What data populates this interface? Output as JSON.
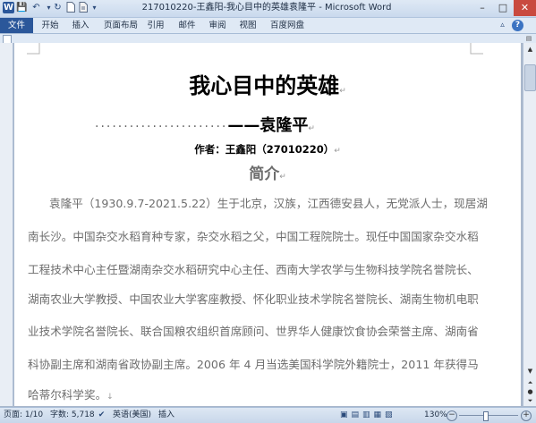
{
  "window": {
    "title": "217010220-王鑫阳-我心目中的英雄袁隆平  -  Microsoft Word",
    "controls": {
      "minimize": "–",
      "maximize": "□",
      "close": "✕"
    }
  },
  "quick_access": {
    "word_icon": "W",
    "save": "💾",
    "undo": "↶",
    "redo": "↻"
  },
  "ribbon": {
    "tabs": [
      "文件",
      "开始",
      "插入",
      "页面布局",
      "引用",
      "邮件",
      "审阅",
      "视图",
      "百度网盘"
    ]
  },
  "document": {
    "title": "我心目中的英雄",
    "leader": "·······················",
    "dash_name": "——袁隆平",
    "author": "作者：王鑫阳（27010220）",
    "section_heading": "简介",
    "body_lines": [
      "袁隆平（1930.9.7-2021.5.22）生于北京，汉族，江西德安县人，无党派人士，现居湖",
      "南长沙。中国杂交水稻育种专家，杂交水稻之父，中国工程院院士。现任中国国家杂交水稻",
      "工程技术中心主任暨湖南杂交水稻研究中心主任、西南大学农学与生物科技学院名誉院长、",
      "湖南农业大学教授、中国农业大学客座教授、怀化职业技术学院名誉院长、湖南生物机电职",
      "业技术学院名誉院长、联合国粮农组织首席顾问、世界华人健康饮食协会荣誉主席、湖南省",
      "科协副主席和湖南省政协副主席。2006 年 4 月当选美国科学院外籍院士，2011 年获得马",
      "哈蒂尔科学奖。"
    ]
  },
  "status_bar": {
    "page": "页面: 1/10",
    "words": "字数: 5,718",
    "language": "英语(美国)",
    "mode": "插入",
    "zoom": "130%"
  }
}
